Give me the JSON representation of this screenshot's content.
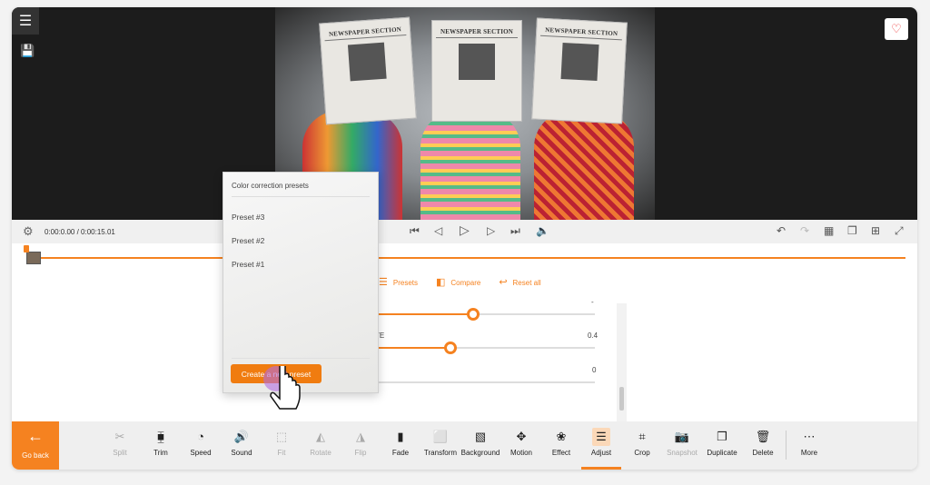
{
  "player": {
    "time": "0:00:0.00 / 0:00:15.01",
    "newspaper_text": "NEWSPAPER SECTION"
  },
  "adjust": {
    "presets": "Presets",
    "compare": "Compare",
    "reset_all": "Reset all",
    "slider1_value": "-",
    "slider1_level": 0.45,
    "slider2_label": "TE",
    "slider2_value": "0.4",
    "slider2_level": 0.35,
    "slider3_value": "0"
  },
  "popup": {
    "title": "Color correction presets",
    "items": [
      "Preset #3",
      "Preset #2",
      "Preset #1"
    ],
    "create": "Create a new preset"
  },
  "toolbar": {
    "go_back": "Go back",
    "items": [
      {
        "label": "Split",
        "icon": "✂",
        "disabled": true
      },
      {
        "label": "Trim",
        "icon": "⧯",
        "disabled": false
      },
      {
        "label": "Speed",
        "icon": "◔",
        "disabled": false
      },
      {
        "label": "Sound",
        "icon": "🔊",
        "disabled": false
      },
      {
        "label": "Fit",
        "icon": "⬚",
        "disabled": true
      },
      {
        "label": "Rotate",
        "icon": "◭",
        "disabled": true
      },
      {
        "label": "Flip",
        "icon": "◮",
        "disabled": true
      },
      {
        "label": "Fade",
        "icon": "▮",
        "disabled": false
      },
      {
        "label": "Transform",
        "icon": "⬜",
        "disabled": false
      },
      {
        "label": "Background",
        "icon": "▧",
        "disabled": false
      },
      {
        "label": "Motion",
        "icon": "✥",
        "disabled": false
      },
      {
        "label": "Effect",
        "icon": "❀",
        "disabled": false
      },
      {
        "label": "Adjust",
        "icon": "☰",
        "disabled": false,
        "active": true
      },
      {
        "label": "Crop",
        "icon": "⌗",
        "disabled": false
      },
      {
        "label": "Snapshot",
        "icon": "📷",
        "disabled": true
      },
      {
        "label": "Duplicate",
        "icon": "❐",
        "disabled": false
      },
      {
        "label": "Delete",
        "icon": "🗑",
        "disabled": false
      }
    ],
    "more": "More"
  },
  "colors": {
    "accent": "#f58220"
  }
}
